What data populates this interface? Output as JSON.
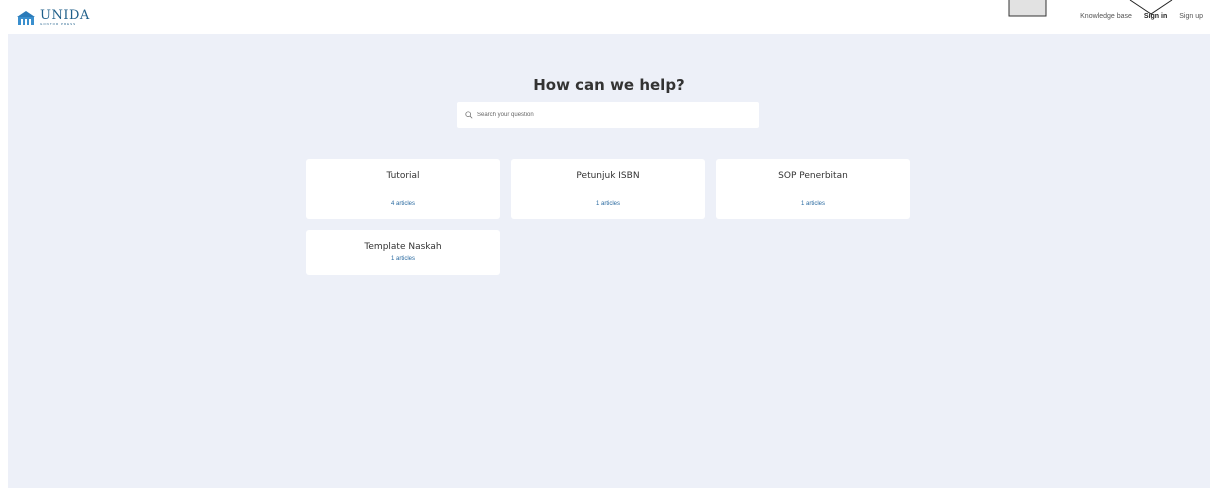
{
  "header": {
    "logo_name": "UNIDA",
    "logo_sub": "GONTOR PRESS",
    "nav": [
      {
        "label": "Knowledge base",
        "active": false
      },
      {
        "label": "Sign in",
        "active": true
      },
      {
        "label": "Sign up",
        "active": false
      }
    ]
  },
  "main": {
    "title": "How can we help?",
    "search": {
      "placeholder": "Search your question",
      "value": ""
    },
    "categories": [
      {
        "name": "Tutorial",
        "count": "4 articles"
      },
      {
        "name": "Petunjuk ISBN",
        "count": "1 articles"
      },
      {
        "name": "SOP Penerbitan",
        "count": "1 articles"
      },
      {
        "name": "Template Naskah",
        "count": "1 articles"
      }
    ]
  },
  "colors": {
    "background": "#edf0f8",
    "link": "#2a6aa0",
    "brand": "#1f5f8a"
  }
}
